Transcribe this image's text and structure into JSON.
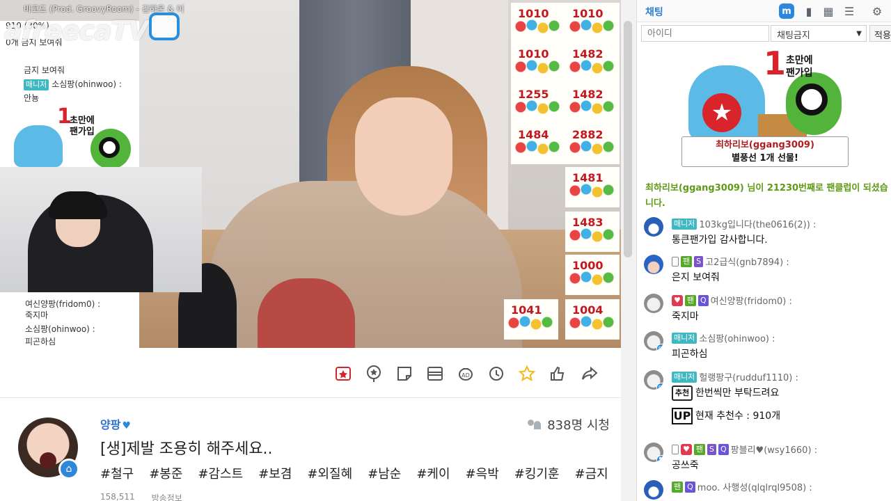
{
  "video": {
    "song_text": "바코드 (Prod. GroovyRoom) - 김하온 & 이",
    "logo_text": "afreecaTV",
    "overlay_chat": [
      {
        "text": "910 (30%)"
      },
      {
        "text": "0개 금지 보여줘"
      },
      {
        "text": "금지 보여줘"
      },
      {
        "badge": "매니저",
        "user": "소심팡(ohinwoo) :",
        "msg": "안뇽"
      }
    ],
    "overlay_chat_bottom": [
      {
        "user": "여신양팡(fridom0) :",
        "msg": "죽지마"
      },
      {
        "user": "소심팡(ohinwoo) :",
        "msg": "피곤하심"
      }
    ],
    "cat_banner": {
      "num": "1",
      "text_line1": "초만에",
      "text_line2": "팬가입"
    },
    "balloons": [
      "1010",
      "1010",
      "1010",
      "1482",
      "1255",
      "1482",
      "1484",
      "2882",
      "1481",
      "1483",
      "1000",
      "1041",
      "1004"
    ]
  },
  "toolbar": {
    "icons": [
      "fan-badge",
      "star-balloon",
      "sticker",
      "quickview",
      "adballoon",
      "timeshift",
      "favorite",
      "up-recommend",
      "share"
    ]
  },
  "broadcast": {
    "bj_name": "양팡",
    "bj_heart": "♥",
    "viewers": "838명 시청",
    "title": "[생]제발 조용히 해주세요..",
    "tags": [
      "#철구",
      "#봉준",
      "#감스트",
      "#보겸",
      "#외질혜",
      "#남순",
      "#케이",
      "#윽박",
      "#킹기훈",
      "#금지"
    ],
    "stats": [
      "158,511",
      "방송정보"
    ]
  },
  "chat": {
    "title": "채팅",
    "id_placeholder": "아이디",
    "ban_select": "채팅금지",
    "apply_label": "적용",
    "gift": {
      "num": "1",
      "head_line1": "초만에",
      "head_line2": "팬가입",
      "label_line1": "최하리보(ggang3009)",
      "label_line2": "별풍선 1개 선물!"
    },
    "system_message": "최하리보(ggang3009) 님이 21230번째로 팬클럽이 되셨습니다.",
    "messages": [
      {
        "badges": [
          "매니저"
        ],
        "user": "103kg입니다(the0616(2)) :",
        "body": "통큰팬가입 감사합니다."
      },
      {
        "badges": [
          "팬",
          "S"
        ],
        "user": "고2급식(gnb7894) :",
        "body": "은지 보여줘"
      },
      {
        "badges": [
          "팬",
          "Q"
        ],
        "user": "여신양팡(fridom0) :",
        "body": "죽지마"
      },
      {
        "badges": [
          "매니저"
        ],
        "user": "소심팡(ohinwoo) :",
        "body": "피곤하심"
      },
      {
        "badges": [
          "매니저"
        ],
        "user": "헐랭팡구(rudduf1110) :",
        "body": "한번씩만 부탁드려요",
        "body2": "현재 추천수 : 910개",
        "rec_label": "추천",
        "up_label": "UP"
      },
      {
        "badges": [
          "팬",
          "S",
          "Q"
        ],
        "user": "팡블리♥(wsy1660) :",
        "body": "공쓰죽"
      },
      {
        "badges": [
          "팬",
          "Q"
        ],
        "user": "moo. 사행성(qlqlrql9508) :",
        "body": ""
      }
    ]
  }
}
